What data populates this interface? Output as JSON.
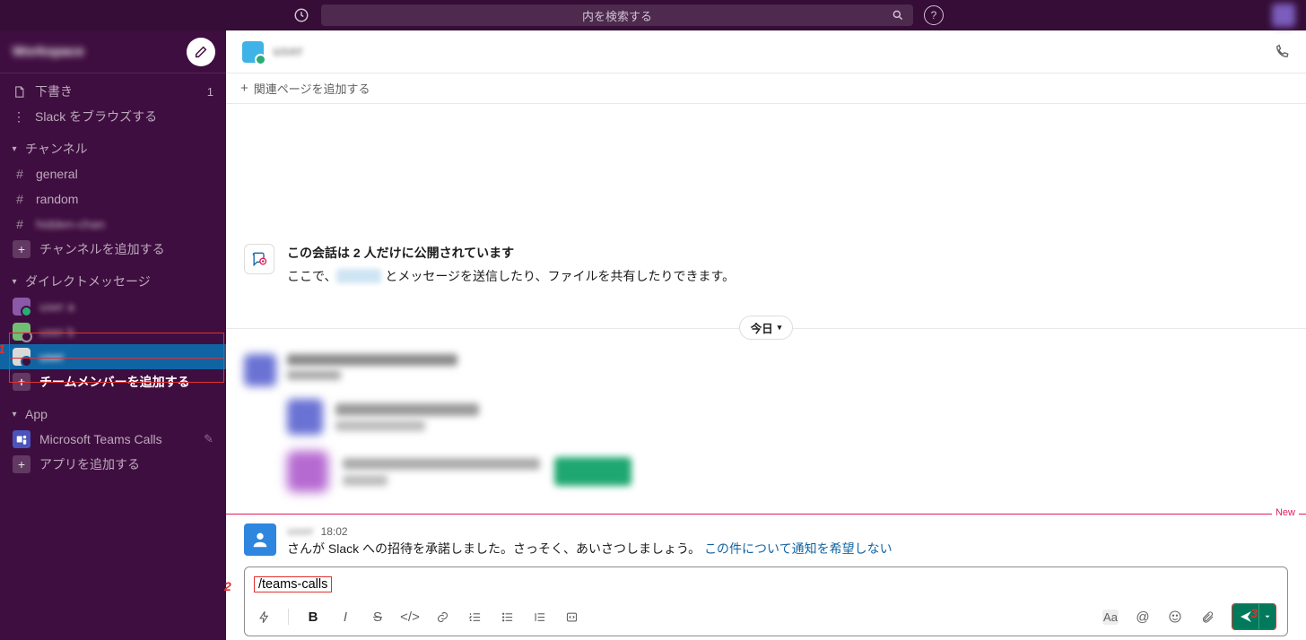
{
  "topbar": {
    "search_placeholder": "内を検索する"
  },
  "sidebar": {
    "workspace_name": "Workspace",
    "drafts_label": "下書き",
    "drafts_count": "1",
    "browse_label": "Slack をブラウズする",
    "channels_head": "チャンネル",
    "channels": [
      {
        "name": "general"
      },
      {
        "name": "random"
      },
      {
        "name": "hidden-chan",
        "blurred": true
      }
    ],
    "add_channel": "チャンネルを追加する",
    "dm_head": "ダイレクトメッセージ",
    "dms": [
      {
        "name": "user a",
        "blurred": true
      },
      {
        "name": "user b",
        "blurred": true
      },
      {
        "name": "user",
        "blurred": true,
        "active": true
      }
    ],
    "add_member": "チームメンバーを追加する",
    "app_head": "App",
    "app_name": "Microsoft Teams Calls",
    "add_app": "アプリを追加する"
  },
  "header": {
    "dm_name": "user",
    "add_pages": "関連ページを追加する"
  },
  "intro": {
    "title": "この会話は 2 人だけに公開されています",
    "body_prefix": "ここで、",
    "body_suffix": " とメッセージを送信したり、ファイルを共有したりできます。"
  },
  "date_divider": "今日",
  "new_label": "New",
  "join_msg": {
    "time": "18:02",
    "body": "さんが Slack への招待を承諾しました。さっそく、あいさつしましょう。",
    "link": "この件について通知を希望しない"
  },
  "composer": {
    "command": "/teams-calls"
  },
  "annotations": {
    "one": "1",
    "two": "2",
    "three": "3"
  }
}
